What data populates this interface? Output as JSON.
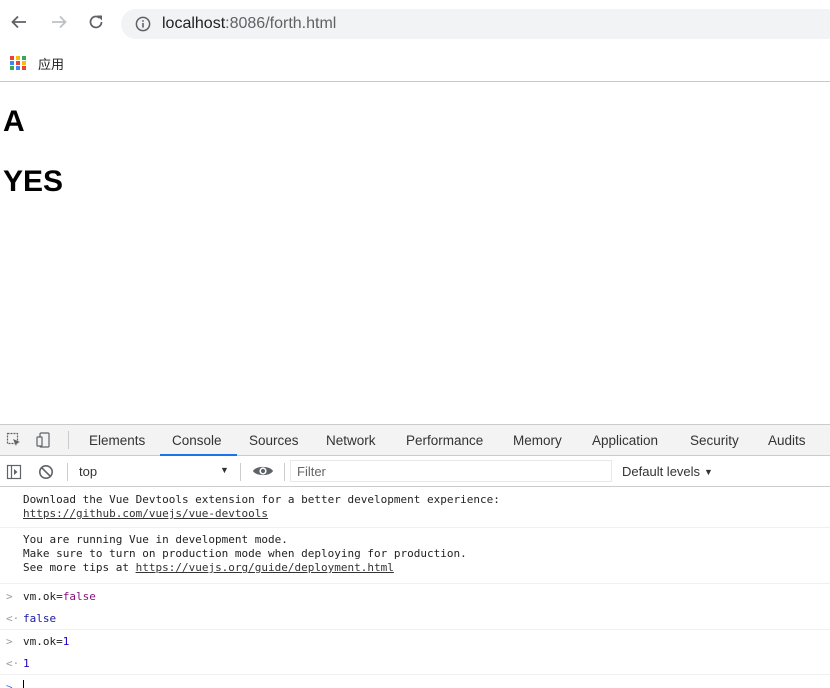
{
  "browser": {
    "url_host": "localhost",
    "url_rest": ":8086/forth.html",
    "bookmarks": {
      "apps_label": "应用"
    }
  },
  "page": {
    "headings": [
      "A",
      "YES"
    ]
  },
  "devtools": {
    "tabs": [
      "Elements",
      "Console",
      "Sources",
      "Network",
      "Performance",
      "Memory",
      "Application",
      "Security",
      "Audits"
    ],
    "active_tab": "Console",
    "context": "top",
    "filter_placeholder": "Filter",
    "levels": "Default levels",
    "messages": [
      {
        "line1": "Download the Vue Devtools extension for a better development experience:",
        "link": "https://github.com/vuejs/vue-devtools"
      },
      {
        "line1": "You are running Vue in development mode.",
        "line2": "Make sure to turn on production mode when deploying for production.",
        "line3_prefix": "See more tips at ",
        "link": "https://vuejs.org/guide/deployment.html"
      }
    ],
    "commands": [
      {
        "input_prefix": "vm.ok=",
        "input_value": "false",
        "output": "false"
      },
      {
        "input_prefix": "vm.ok=",
        "input_value": "1",
        "output": "1"
      }
    ]
  },
  "colors": {
    "accent": "#1a73e8",
    "apps_grid": [
      "#ea4335",
      "#fbbc05",
      "#34a853",
      "#4285f4",
      "#ea4335",
      "#fbbc05",
      "#34a853",
      "#4285f4",
      "#ea4335"
    ]
  }
}
